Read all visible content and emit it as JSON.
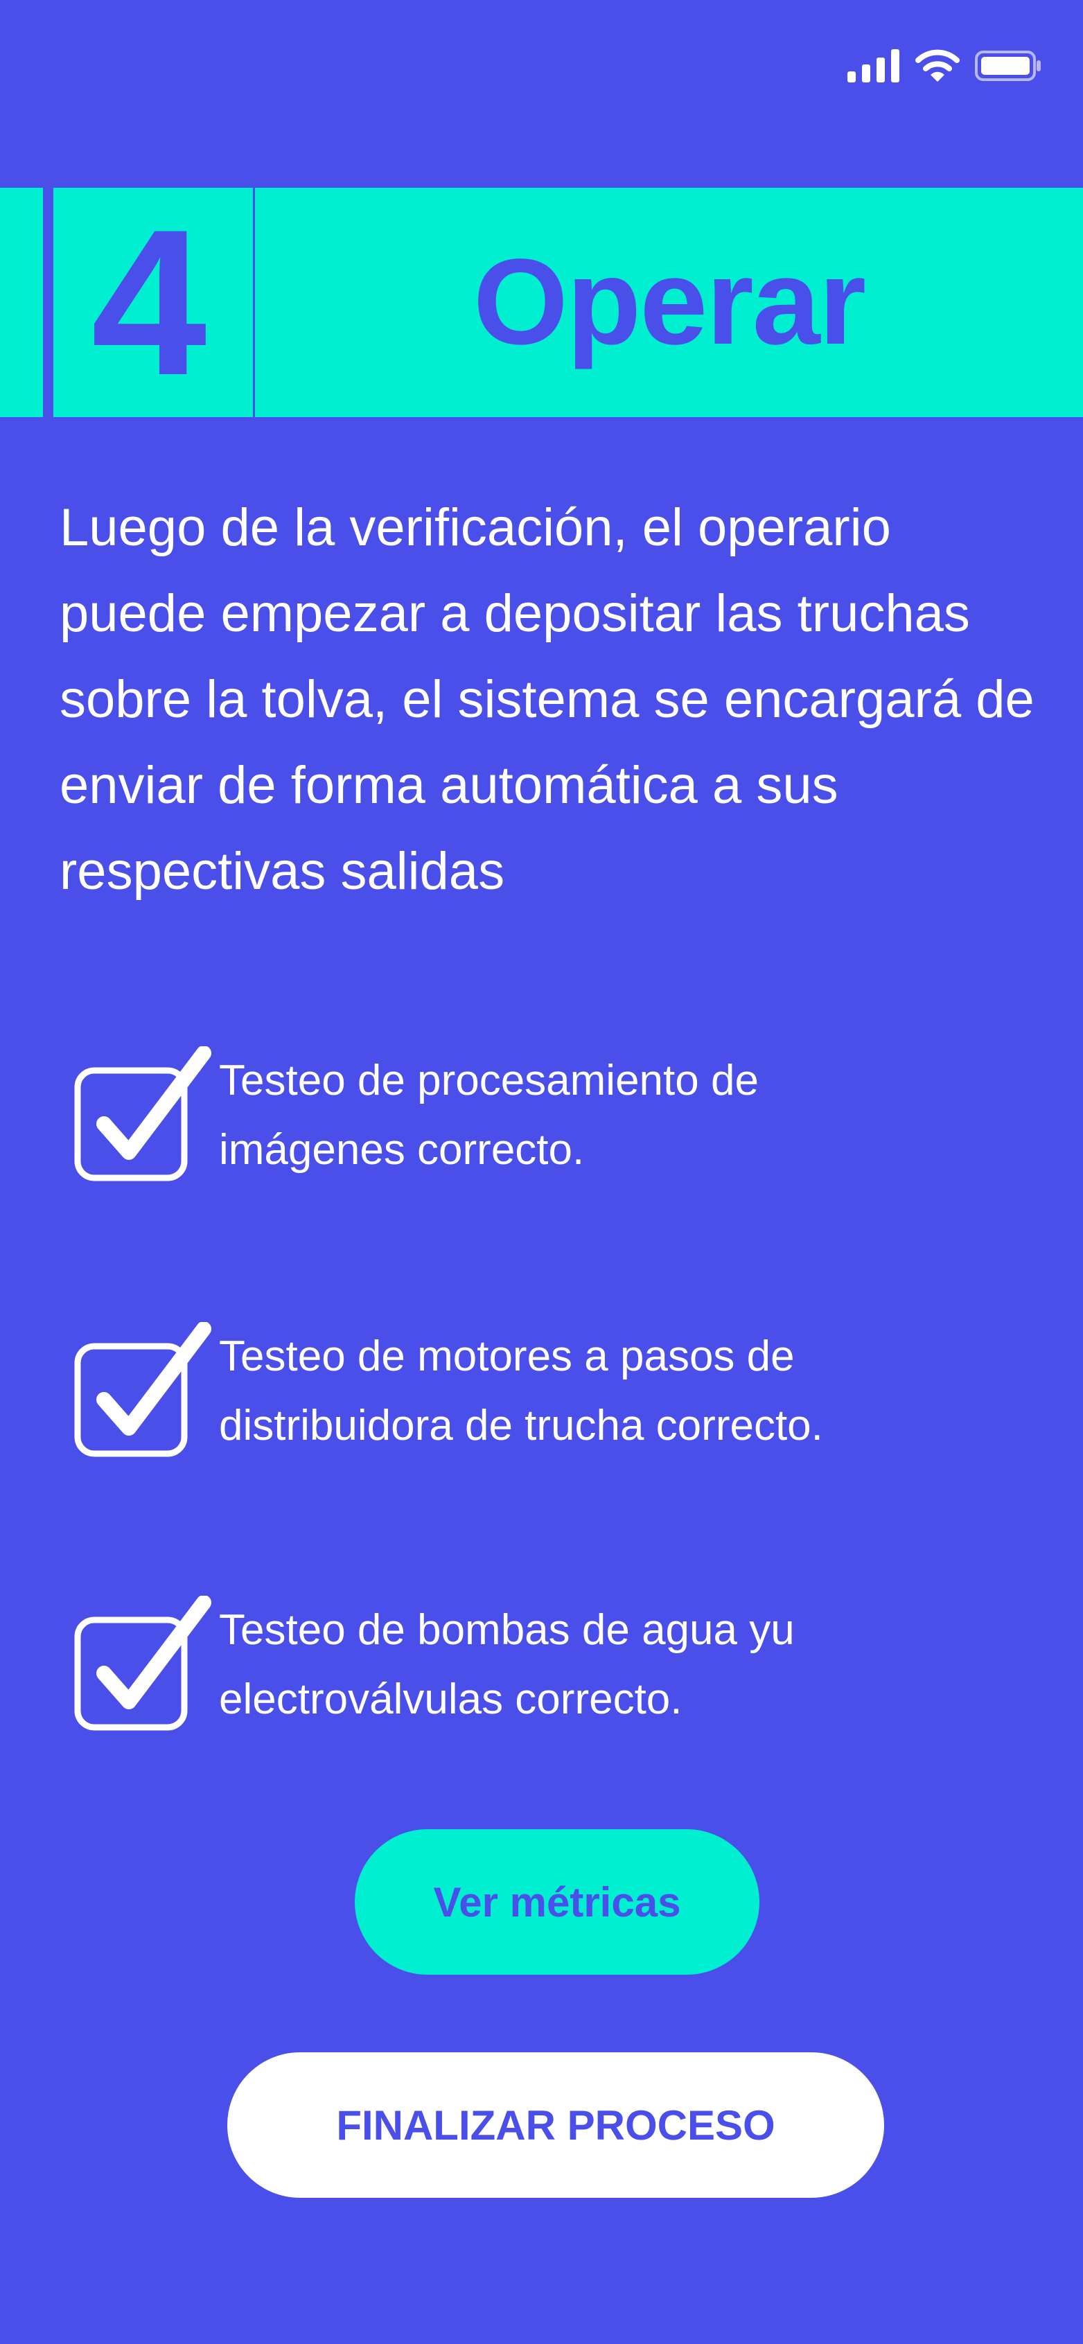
{
  "status_bar": {
    "icons": [
      "signal-bars-icon",
      "wifi-icon",
      "battery-icon"
    ]
  },
  "step": {
    "number": "4",
    "title": "Operar"
  },
  "description": "Luego de la verificación, el operario puede empezar a depositar las truchas sobre la tolva, el sistema se encargará de enviar de forma automática a sus respectivas salidas",
  "checklist": [
    {
      "line1": "Testeo de procesamiento de",
      "line2": "imágenes correcto.",
      "checked": true
    },
    {
      "line1": "Testeo de motores a pasos de",
      "line2": "distribuidora de trucha correcto.",
      "checked": true
    },
    {
      "line1": "Testeo de bombas de agua yu",
      "line2": "electroválvulas correcto.",
      "checked": true
    }
  ],
  "buttons": {
    "metrics_label": "Ver métricas",
    "finish_label": "FINALIZAR PROCESO"
  },
  "colors": {
    "background": "#4b4fe9",
    "accent": "#00efd1",
    "text": "#ffffff"
  }
}
